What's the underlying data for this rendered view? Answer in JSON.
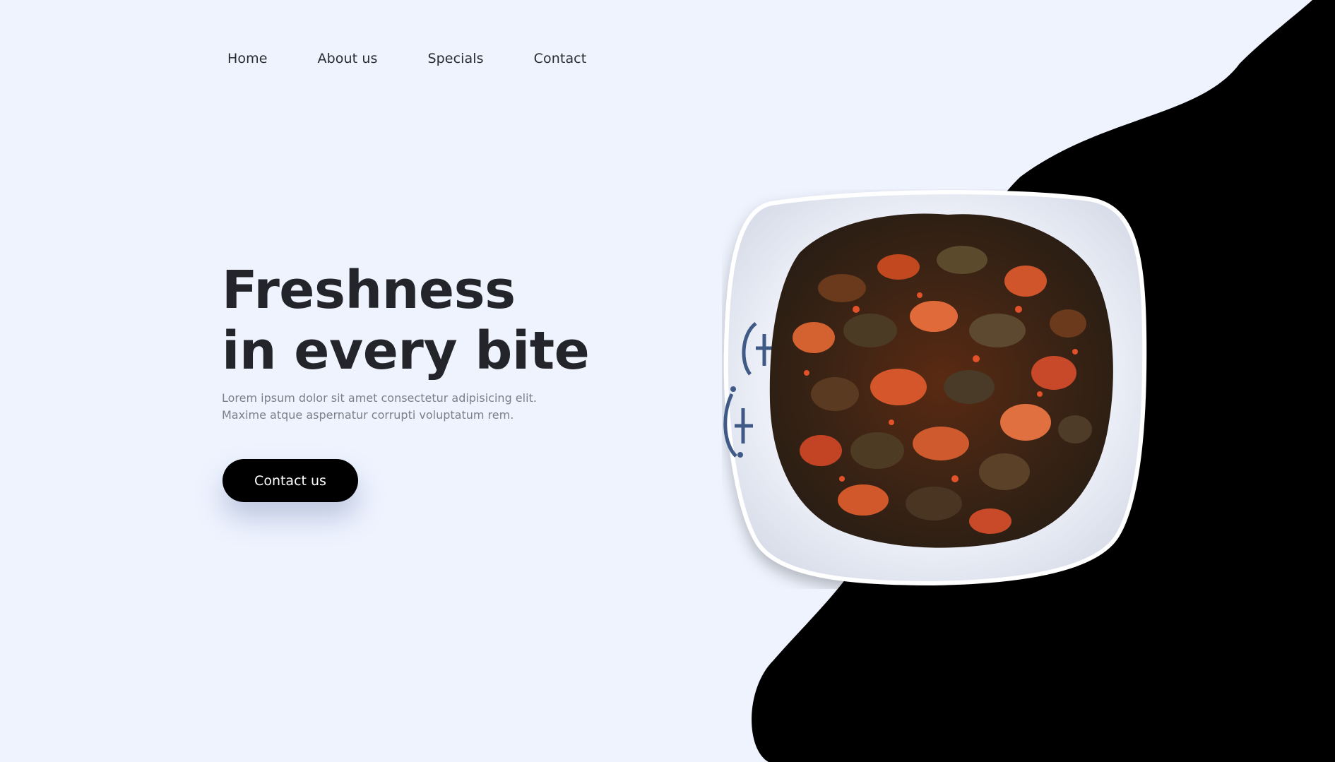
{
  "nav": {
    "items": [
      "Home",
      "About us",
      "Specials",
      "Contact"
    ]
  },
  "hero": {
    "title_line1": "Freshness",
    "title_line2": "in every bite",
    "description": "Lorem ipsum dolor sit amet consectetur adipisicing elit. Maxime atque aspernatur corrupti voluptatum rem.",
    "cta_label": "Contact us"
  },
  "colors": {
    "background": "#eef3fe",
    "blob": "#000000",
    "heading": "#23252b",
    "body_text": "#7c7f88",
    "button_bg": "#000000",
    "button_text": "#ffffff"
  },
  "images": {
    "hero_dish": "bowl-of-spicy-pickled-vegetables"
  }
}
